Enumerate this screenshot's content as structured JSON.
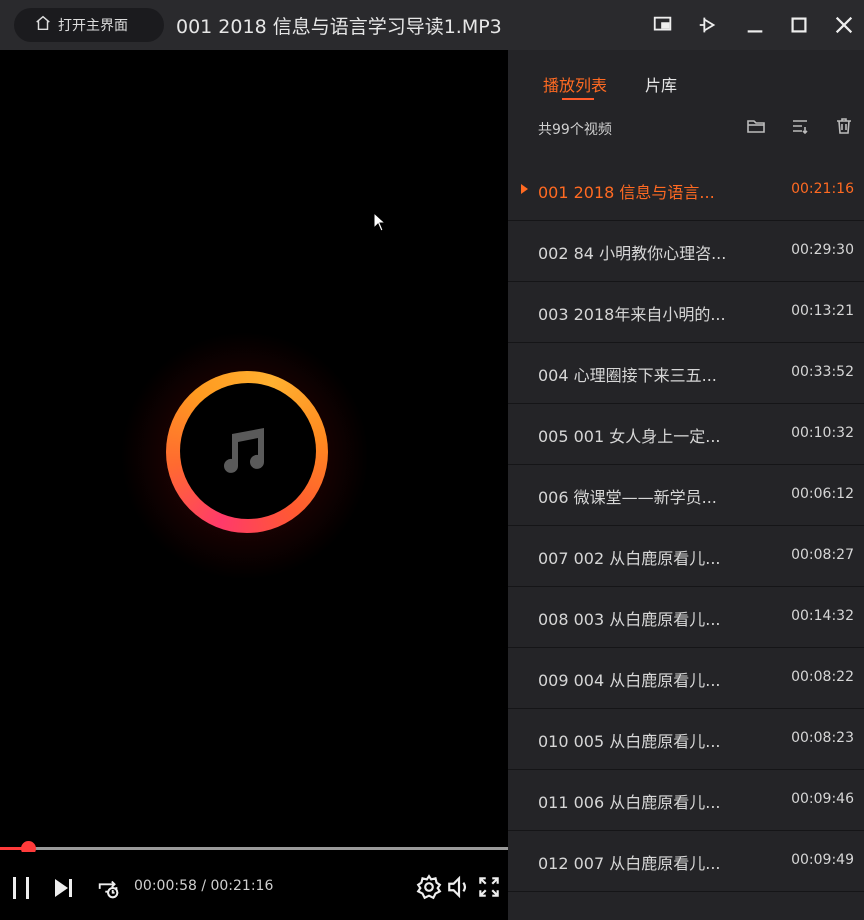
{
  "titlebar": {
    "home_label": "打开主界面",
    "title": "001 2018 信息与语言学习导读1.MP3"
  },
  "player": {
    "time_display": "00:00:58 / 00:21:16",
    "progress": 0.045
  },
  "sidebar": {
    "tabs": [
      "播放列表",
      "片库"
    ],
    "count_label": "共99个视频",
    "items": [
      {
        "label": "001 2018 信息与语言...",
        "duration": "00:21:16"
      },
      {
        "label": "002 84 小明教你心理咨...",
        "duration": "00:29:30"
      },
      {
        "label": "003 2018年来自小明的...",
        "duration": "00:13:21"
      },
      {
        "label": "004 心理圈接下来三五...",
        "duration": "00:33:52"
      },
      {
        "label": "005 001 女人身上一定...",
        "duration": "00:10:32"
      },
      {
        "label": "006 微课堂——新学员...",
        "duration": "00:06:12"
      },
      {
        "label": "007 002 从白鹿原看儿...",
        "duration": "00:08:27"
      },
      {
        "label": "008 003 从白鹿原看儿...",
        "duration": "00:14:32"
      },
      {
        "label": "009 004 从白鹿原看儿...",
        "duration": "00:08:22"
      },
      {
        "label": "010 005 从白鹿原看儿...",
        "duration": "00:08:23"
      },
      {
        "label": "011 006 从白鹿原看儿...",
        "duration": "00:09:46"
      },
      {
        "label": "012 007 从白鹿原看儿...",
        "duration": "00:09:49"
      }
    ]
  },
  "colors": {
    "accent": "#ff6a22",
    "progress": "#ff3b3b"
  }
}
